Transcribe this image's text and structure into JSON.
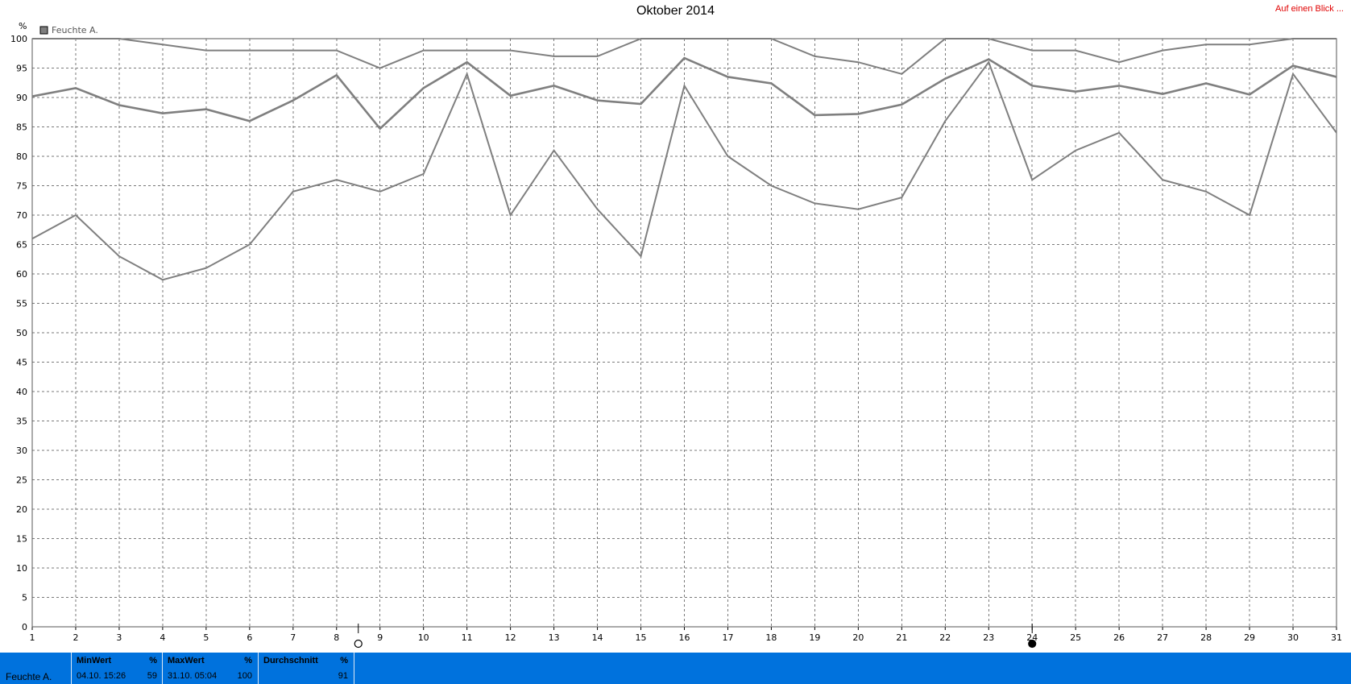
{
  "header": {
    "title": "Oktober 2014",
    "glance_link": "Auf einen Blick ..."
  },
  "chart_data": {
    "type": "line",
    "title": "Oktober 2014",
    "ylabel": "%",
    "xlabel": "",
    "ylim": [
      0,
      100
    ],
    "yticks": [
      0,
      5,
      10,
      15,
      20,
      25,
      30,
      35,
      40,
      45,
      50,
      55,
      60,
      65,
      70,
      75,
      80,
      85,
      90,
      95,
      100
    ],
    "x": [
      1,
      2,
      3,
      4,
      5,
      6,
      7,
      8,
      9,
      10,
      11,
      12,
      13,
      14,
      15,
      16,
      17,
      18,
      19,
      20,
      21,
      22,
      23,
      24,
      25,
      26,
      27,
      28,
      29,
      30,
      31
    ],
    "legend": {
      "label": "Feuchte A.",
      "placement": "top-left"
    },
    "grid": true,
    "series": [
      {
        "role": "max",
        "values": [
          100,
          100,
          100,
          99,
          98,
          98,
          98,
          98,
          95,
          98,
          98,
          98,
          97,
          97,
          100,
          100,
          100,
          100,
          97,
          96,
          94,
          100,
          100,
          98,
          98,
          96,
          98,
          99,
          99,
          100,
          100
        ]
      },
      {
        "role": "avg",
        "values": [
          90.2,
          91.6,
          88.7,
          87.3,
          88,
          86,
          89.5,
          93.8,
          84.7,
          91.6,
          96,
          90.3,
          92,
          89.5,
          88.9,
          96.7,
          93.5,
          92.4,
          87,
          87.2,
          88.8,
          93.2,
          96.5,
          92,
          91,
          92,
          90.6,
          92.4,
          90.5,
          95.4,
          93.5
        ]
      },
      {
        "role": "min",
        "values": [
          66,
          70,
          63,
          59,
          61,
          65,
          74,
          76,
          74,
          77,
          94,
          70,
          81,
          71,
          63,
          92,
          80,
          75,
          72,
          71,
          73,
          86,
          96,
          76,
          81,
          84,
          76,
          74,
          70,
          94,
          84
        ]
      }
    ],
    "line_color": "#7f7f7f",
    "markers": [
      {
        "kind": "open-circle",
        "x": 8.5
      },
      {
        "kind": "filled-circle",
        "x": 24
      }
    ]
  },
  "stats": {
    "series_name": "Feuchte A.",
    "min": {
      "label": "MinWert",
      "unit": "%",
      "date": "04.10.  15:26",
      "value": "59"
    },
    "max": {
      "label": "MaxWert",
      "unit": "%",
      "date": "31.10.  05:04",
      "value": "100"
    },
    "avg": {
      "label": "Durchschnitt",
      "unit": "%",
      "date": "",
      "value": "91"
    }
  },
  "colors": {
    "statusbar": "#0072dd",
    "glance_link": "#e00000",
    "series": "#7f7f7f",
    "grid": "#7a7a7a"
  }
}
